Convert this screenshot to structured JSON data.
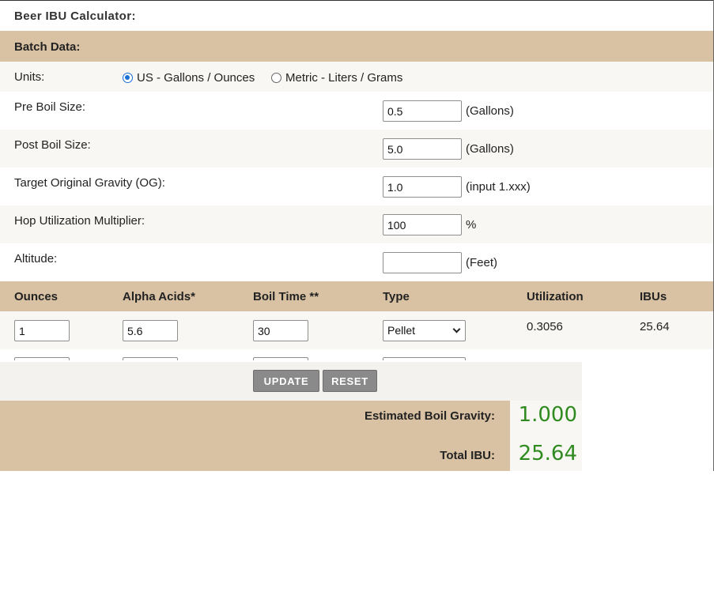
{
  "title": "Beer IBU Calculator:",
  "batch": {
    "header": "Batch Data:",
    "units_label": "Units:",
    "units_options": [
      {
        "label": "US - Gallons / Ounces",
        "selected": true
      },
      {
        "label": "Metric - Liters / Grams",
        "selected": false
      }
    ],
    "fields": [
      {
        "label": "Pre Boil Size:",
        "value": "0.5",
        "unit": "(Gallons)"
      },
      {
        "label": "Post Boil Size:",
        "value": "5.0",
        "unit": "(Gallons)"
      },
      {
        "label": "Target Original Gravity (OG):",
        "value": "1.0",
        "unit": "(input 1.xxx)"
      },
      {
        "label": "Hop Utilization Multiplier:",
        "value": "100",
        "unit": "%"
      },
      {
        "label": "Altitude:",
        "value": "",
        "unit": "(Feet)"
      }
    ]
  },
  "hops": {
    "headers": [
      "Ounces",
      "Alpha Acids*",
      "Boil Time **",
      "Type",
      "Utilization",
      "IBUs"
    ],
    "rows": [
      {
        "ounces": "1",
        "alpha": "5.6",
        "boil_time": "30",
        "type": "Pellet",
        "utilization": "0.3056",
        "ibus": "25.64"
      }
    ]
  },
  "buttons": {
    "update": "UPDATE",
    "reset": "RESET"
  },
  "results": {
    "gravity_label": "Estimated Boil Gravity:",
    "gravity_value": "1.000",
    "ibu_label": "Total IBU:",
    "ibu_value": "25.64"
  },
  "colors": {
    "header_bg": "#d9c2a3",
    "row_light": "#f8f7f3",
    "result_green": "#2f8a1f",
    "button_gray": "#8a8a8a",
    "radio_blue": "#1a6fd6"
  },
  "icons": {
    "radio_selected": "radio-checked-icon",
    "radio_unselected": "radio-unchecked-icon",
    "select_chevron": "chevron-down-icon"
  }
}
